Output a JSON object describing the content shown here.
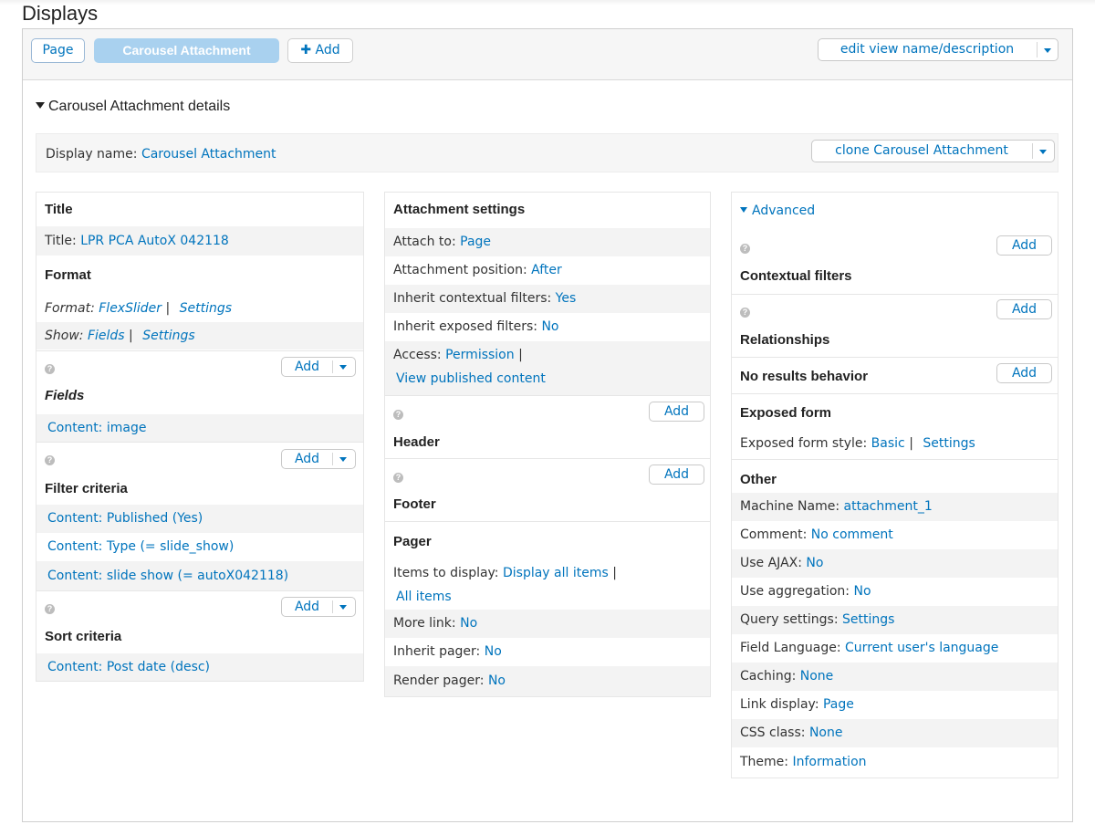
{
  "page": {
    "title": "Displays"
  },
  "tabs": {
    "page": "Page",
    "carousel": "Carousel Attachment",
    "add": "Add",
    "edit_view": "edit view name/description"
  },
  "details": {
    "heading": "Carousel Attachment details",
    "display_name_label": "Display name:",
    "display_name_value": "Carousel Attachment",
    "clone": "clone Carousel Attachment"
  },
  "left": {
    "title_heading": "Title",
    "title_label": "Title:",
    "title_value": "LPR PCA AutoX 042118",
    "format_heading": "Format",
    "format_label": "Format:",
    "format_value": "FlexSlider",
    "format_settings": "Settings",
    "show_label": "Show:",
    "show_value": "Fields",
    "show_settings": "Settings",
    "add": "Add",
    "fields_heading": "Fields",
    "fields_items": [
      "Content: image"
    ],
    "filter_heading": "Filter criteria",
    "filter_items": [
      "Content: Published (Yes)",
      "Content: Type (= slide_show)",
      "Content: slide show (= autoX042118)"
    ],
    "sort_heading": "Sort criteria",
    "sort_items": [
      "Content: Post date (desc)"
    ]
  },
  "middle": {
    "attach_heading": "Attachment settings",
    "attach_to_label": "Attach to:",
    "attach_to_value": "Page",
    "position_label": "Attachment position:",
    "position_value": "After",
    "inherit_ctx_label": "Inherit contextual filters:",
    "inherit_ctx_value": "Yes",
    "inherit_exp_label": "Inherit exposed filters:",
    "inherit_exp_value": "No",
    "access_label": "Access:",
    "access_value": "Permission",
    "access_detail": "View published content",
    "add": "Add",
    "header_heading": "Header",
    "footer_heading": "Footer",
    "pager_heading": "Pager",
    "items_label": "Items to display:",
    "items_value": "Display all items",
    "items_detail": "All items",
    "more_label": "More link:",
    "more_value": "No",
    "inherit_pager_label": "Inherit pager:",
    "inherit_pager_value": "No",
    "render_pager_label": "Render pager:",
    "render_pager_value": "No"
  },
  "right": {
    "advanced": "Advanced",
    "add": "Add",
    "contextual_heading": "Contextual filters",
    "relationships_heading": "Relationships",
    "noresults_heading": "No results behavior",
    "exposed_heading": "Exposed form",
    "exposed_style_label": "Exposed form style:",
    "exposed_style_value": "Basic",
    "exposed_settings": "Settings",
    "other_heading": "Other",
    "other_rows": [
      {
        "label": "Machine Name:",
        "value": "attachment_1"
      },
      {
        "label": "Comment:",
        "value": "No comment"
      },
      {
        "label": "Use AJAX:",
        "value": "No"
      },
      {
        "label": "Use aggregation:",
        "value": "No"
      },
      {
        "label": "Query settings:",
        "value": "Settings"
      },
      {
        "label": "Field Language:",
        "value": "Current user's language"
      },
      {
        "label": "Caching:",
        "value": "None"
      },
      {
        "label": "Link display:",
        "value": "Page"
      },
      {
        "label": "CSS class:",
        "value": "None"
      },
      {
        "label": "Theme:",
        "value": "Information"
      }
    ]
  },
  "colors": {
    "link": "#0074bd",
    "active_tab": "#a9d1ef",
    "row_alt": "#f3f3f3"
  }
}
